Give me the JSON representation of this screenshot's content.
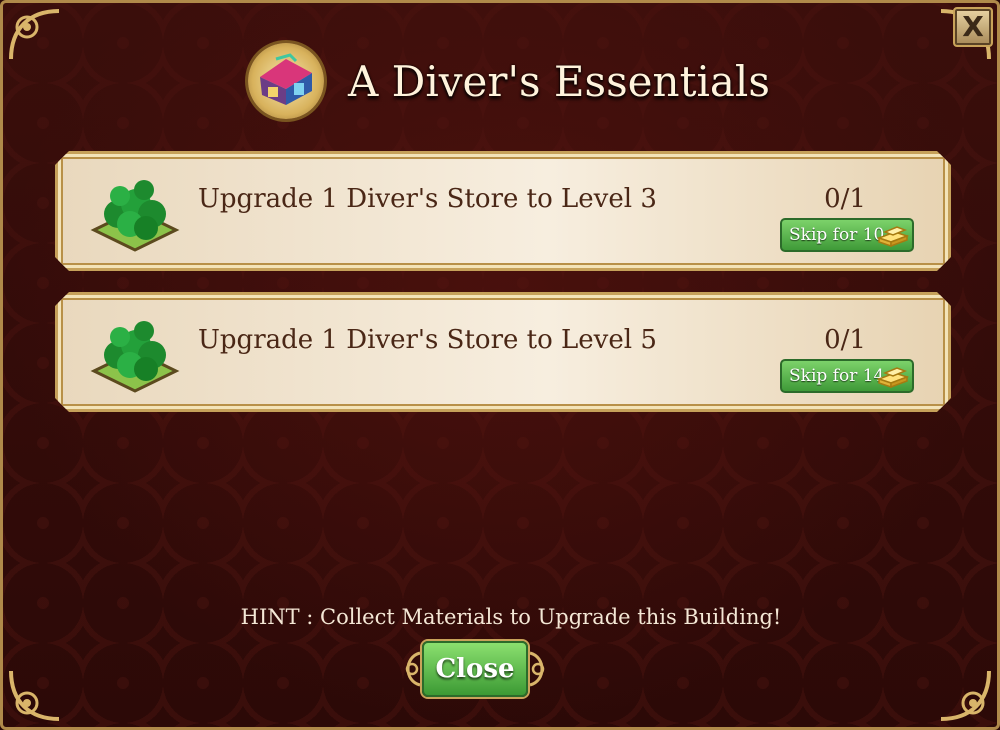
{
  "dialog": {
    "title": "A Diver's Essentials",
    "close_x_label": "X"
  },
  "tasks": [
    {
      "label": "Upgrade 1 Diver's Store to Level 3",
      "progress": "0/1",
      "skip_label": "Skip for 10"
    },
    {
      "label": "Upgrade 1 Diver's Store to Level 5",
      "progress": "0/1",
      "skip_label": "Skip for 14"
    }
  ],
  "hint": "HINT : Collect Materials to Upgrade this Building!",
  "close_label": "Close",
  "icons": {
    "building": "diver-store-building-icon",
    "task": "tree-plot-icon",
    "currency": "gold-bar-icon"
  },
  "colors": {
    "background": "#2c0907",
    "panel": "#f7eedf",
    "text_dark": "#4a2716",
    "button_green": "#3f9a38",
    "border_gold": "#c6a15a"
  }
}
